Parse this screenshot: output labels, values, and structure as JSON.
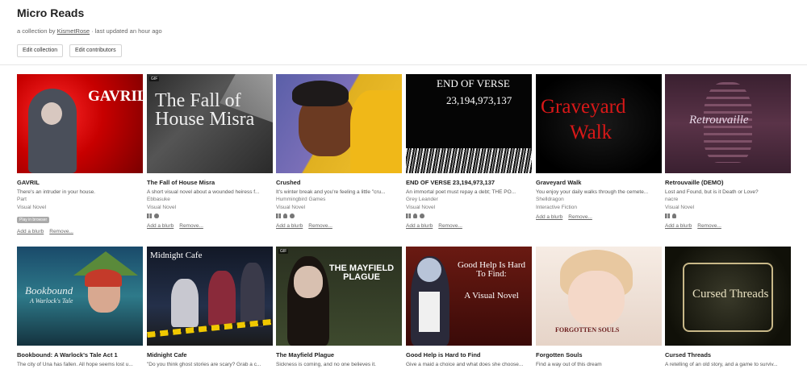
{
  "header": {
    "title": "Micro Reads",
    "subtitle_prefix": "a collection by ",
    "author": "KismetRose",
    "subtitle_suffix": " · last updated an hour ago",
    "edit_collection": "Edit collection",
    "edit_contributors": "Edit contributors"
  },
  "actions": {
    "add_blurb": "Add a blurb",
    "remove": "Remove..."
  },
  "games": [
    {
      "title": "GAVRIL",
      "thumb_text": "GAVRIL",
      "gif": "",
      "desc": "There's an intruder in your house.",
      "author": "Part",
      "genre": "Visual Novel",
      "browser_tag": "Play in browser"
    },
    {
      "title": "The Fall of House Misra",
      "thumb_text": "The Fall of House Misra",
      "gif": "GIF",
      "desc": "A short visual novel about a wounded heiress f...",
      "author": "Ebbasuke",
      "genre": "Visual Novel"
    },
    {
      "title": "Crushed",
      "thumb_text": "",
      "gif": "",
      "desc": "It's winter break and you're feeling a little \"cru...",
      "author": "Hummingbird Games",
      "genre": "Visual Novel"
    },
    {
      "title": "END OF VERSE 23,194,973,137",
      "thumb_text": "END OF VERSE",
      "thumb_text2": "23,194,973,137",
      "gif": "",
      "desc": "An immortal poet must repay a debt; THE PO...",
      "author": "Grey Leander",
      "genre": "Visual Novel"
    },
    {
      "title": "Graveyard Walk",
      "thumb_text": "Graveyard",
      "thumb_text2": "Walk",
      "gif": "",
      "desc": "You enjoy your daily walks through the cemete...",
      "author": "Shelldragon",
      "genre": "Interactive Fiction"
    },
    {
      "title": "Retrouvaille (DEMO)",
      "thumb_text": "Retrouvaille",
      "gif": "",
      "desc": "Lost and Found, but is it Death or Love?",
      "author": "nacre",
      "genre": "Visual Novel"
    },
    {
      "title": "Bookbound: A Warlock's Tale Act 1",
      "thumb_text": "Bookbound",
      "thumb_text2": "A Warlock's Tale",
      "gif": "",
      "desc": "The city of Una has fallen. All hope seems lost u..."
    },
    {
      "title": "Midnight Cafe",
      "thumb_text": "Midnight Cafe",
      "gif": "",
      "desc": "\"Do you think ghost stories are scary? Grab a c..."
    },
    {
      "title": "The Mayfield Plague",
      "thumb_text": "THE MAYFIELD PLAGUE",
      "gif": "GIF",
      "desc": "Sickness is coming, and no one believes it."
    },
    {
      "title": "Good Help is Hard to Find",
      "thumb_text": "Good Help Is Hard To Find:",
      "thumb_text2": "A Visual Novel",
      "gif": "",
      "desc": "Give a maid a choice and what does she choose..."
    },
    {
      "title": "Forgotten Souls",
      "thumb_text": "FORGOTTEN SOULS",
      "gif": "",
      "desc": "Find a way out of this dream"
    },
    {
      "title": "Cursed Threads",
      "thumb_text": "Cursed Threads",
      "gif": "",
      "desc": "A retelling of an old story, and a game to surviv..."
    }
  ]
}
